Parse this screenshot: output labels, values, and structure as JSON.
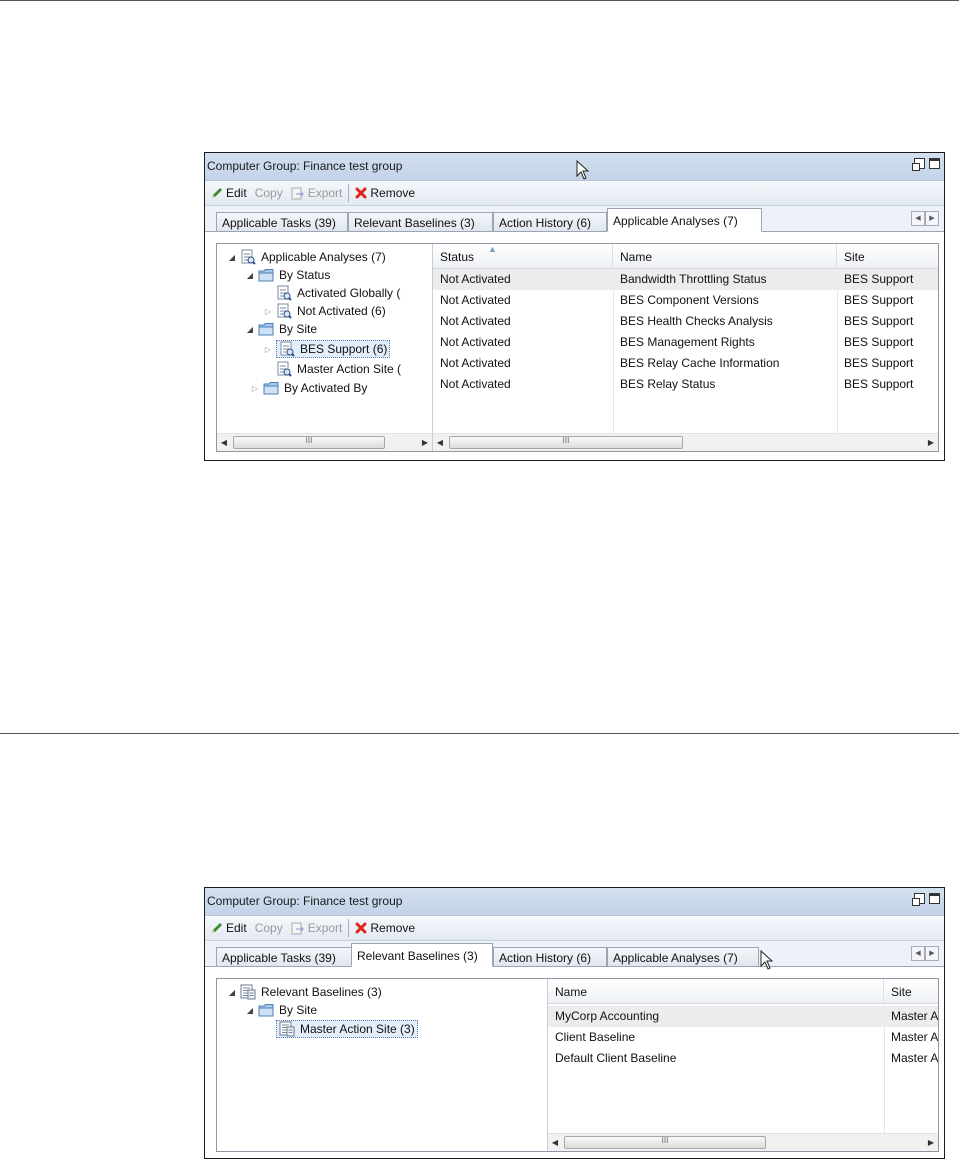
{
  "panel1": {
    "title": "Computer Group: Finance test group",
    "toolbar": {
      "edit": "Edit",
      "copy": "Copy",
      "export": "Export",
      "remove": "Remove"
    },
    "tabs": [
      "Applicable Tasks (39)",
      "Relevant Baselines (3)",
      "Action History (6)",
      "Applicable Analyses (7)"
    ],
    "active_tab": "Applicable Analyses (7)",
    "tree": [
      {
        "label": "Applicable Analyses (7)",
        "icon": "analysis-icon",
        "expander": "expanded"
      },
      {
        "label": "By Status",
        "icon": "folder-icon",
        "expander": "expanded"
      },
      {
        "label": "Activated Globally (",
        "icon": "analysis-icon",
        "expander": "none"
      },
      {
        "label": "Not Activated (6)",
        "icon": "analysis-icon",
        "expander": "collapsed"
      },
      {
        "label": "By Site",
        "icon": "folder-icon",
        "expander": "expanded"
      },
      {
        "label": "BES Support (6)",
        "icon": "analysis-icon",
        "expander": "collapsed",
        "selected": true
      },
      {
        "label": "Master Action Site (",
        "icon": "analysis-icon",
        "expander": "none"
      },
      {
        "label": "By Activated By",
        "icon": "folder-icon",
        "expander": "collapsed"
      }
    ],
    "columns": [
      "Status",
      "Name",
      "Site"
    ],
    "rows": [
      [
        "Not Activated",
        "Bandwidth Throttling Status",
        "BES Support"
      ],
      [
        "Not Activated",
        "BES Component Versions",
        "BES Support"
      ],
      [
        "Not Activated",
        "BES Health Checks Analysis",
        "BES Support"
      ],
      [
        "Not Activated",
        "BES Management Rights",
        "BES Support"
      ],
      [
        "Not Activated",
        "BES Relay Cache Information",
        "BES Support"
      ],
      [
        "Not Activated",
        "BES Relay Status",
        "BES Support"
      ]
    ],
    "scroll_grip": "III"
  },
  "panel2": {
    "title": "Computer Group: Finance test group",
    "toolbar": {
      "edit": "Edit",
      "copy": "Copy",
      "export": "Export",
      "remove": "Remove"
    },
    "tabs": [
      "Applicable Tasks (39)",
      "Relevant Baselines (3)",
      "Action History (6)",
      "Applicable Analyses (7)"
    ],
    "active_tab": "Relevant Baselines (3)",
    "tree": [
      {
        "label": "Relevant Baselines (3)",
        "icon": "baseline-icon",
        "expander": "expanded"
      },
      {
        "label": "By Site",
        "icon": "folder-icon",
        "expander": "expanded"
      },
      {
        "label": "Master Action Site (3)",
        "icon": "baseline-icon",
        "expander": "none",
        "selected": true
      }
    ],
    "columns": [
      "Name",
      "Site"
    ],
    "rows": [
      [
        "MyCorp Accounting",
        "Master A"
      ],
      [
        "Client Baseline",
        "Master A"
      ],
      [
        "Default Client Baseline",
        "Master A"
      ]
    ],
    "scroll_grip": "III"
  },
  "colors": {
    "titlebar": "#c8d7ea",
    "toolbar": "#e8edf4",
    "selection": "#e3eefb",
    "remove_x": "#e2231a",
    "edit_pencil": "#3b8b2e",
    "folder": "#6fa3d8"
  }
}
